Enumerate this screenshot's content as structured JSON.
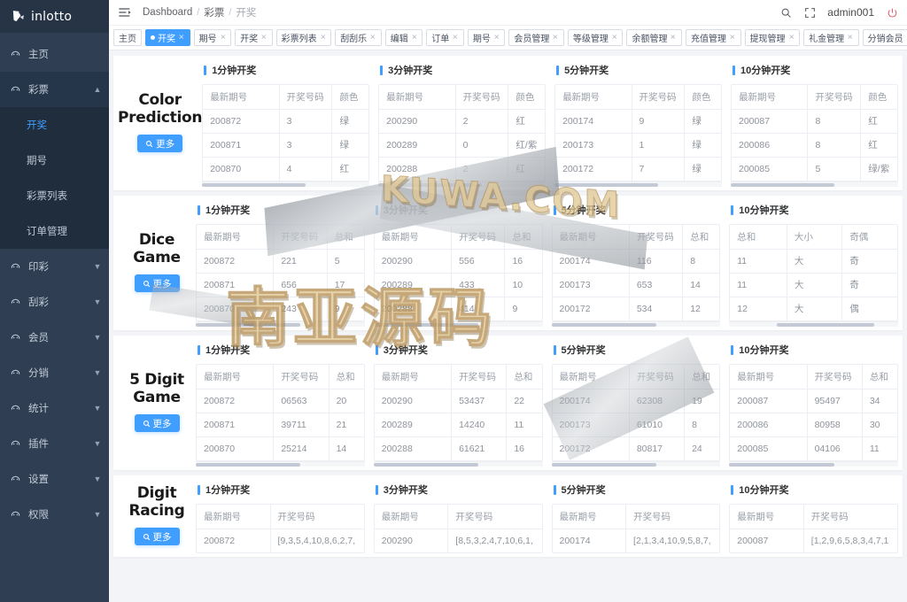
{
  "brand": {
    "name": "inlotto"
  },
  "topbar": {
    "menu_icon": "hamburger-icon",
    "breadcrumb": [
      "Dashboard",
      "彩票",
      "开奖"
    ],
    "separator": "/",
    "search_icon": "search-icon",
    "fullscreen_icon": "fullscreen-icon",
    "username": "admin001",
    "power_icon": "power-icon"
  },
  "tabs": [
    {
      "label": "主页",
      "active": false,
      "closable": false
    },
    {
      "label": "开奖",
      "active": true,
      "closable": true
    },
    {
      "label": "期号",
      "active": false,
      "closable": true
    },
    {
      "label": "开奖",
      "active": false,
      "closable": true
    },
    {
      "label": "彩票列表",
      "active": false,
      "closable": true
    },
    {
      "label": "刮刮乐",
      "active": false,
      "closable": true
    },
    {
      "label": "编辑",
      "active": false,
      "closable": true
    },
    {
      "label": "订单",
      "active": false,
      "closable": true
    },
    {
      "label": "期号",
      "active": false,
      "closable": true
    },
    {
      "label": "会员管理",
      "active": false,
      "closable": true
    },
    {
      "label": "等级管理",
      "active": false,
      "closable": true
    },
    {
      "label": "余额管理",
      "active": false,
      "closable": true
    },
    {
      "label": "充值管理",
      "active": false,
      "closable": true
    },
    {
      "label": "提现管理",
      "active": false,
      "closable": true
    },
    {
      "label": "礼金管理",
      "active": false,
      "closable": true
    },
    {
      "label": "分销会员",
      "active": false,
      "closable": true
    }
  ],
  "sidebar": {
    "items": [
      {
        "label": "主页",
        "icon": "dashboard-icon",
        "expandable": false
      },
      {
        "label": "彩票",
        "icon": "ticket-icon",
        "expandable": true,
        "expanded": true,
        "children": [
          {
            "label": "开奖",
            "active": true
          },
          {
            "label": "期号",
            "active": false
          },
          {
            "label": "彩票列表",
            "active": false
          },
          {
            "label": "订单管理",
            "active": false
          }
        ]
      },
      {
        "label": "印彩",
        "icon": "print-icon",
        "expandable": true,
        "expanded": false
      },
      {
        "label": "刮彩",
        "icon": "scratch-icon",
        "expandable": true,
        "expanded": false
      },
      {
        "label": "会员",
        "icon": "member-icon",
        "expandable": true,
        "expanded": false
      },
      {
        "label": "分销",
        "icon": "distribution-icon",
        "expandable": true,
        "expanded": false
      },
      {
        "label": "统计",
        "icon": "stats-icon",
        "expandable": true,
        "expanded": false
      },
      {
        "label": "插件",
        "icon": "plugin-icon",
        "expandable": true,
        "expanded": false
      },
      {
        "label": "设置",
        "icon": "settings-icon",
        "expandable": true,
        "expanded": false
      },
      {
        "label": "权限",
        "icon": "permission-icon",
        "expandable": true,
        "expanded": false
      }
    ]
  },
  "more_button": {
    "label": "更多",
    "icon": "search-icon"
  },
  "games": [
    {
      "title_line1": "Color",
      "title_line2": "Prediction",
      "panels": [
        {
          "heading": "1分钟开奖",
          "columns": [
            "最新期号",
            "开奖号码",
            "颜色"
          ],
          "col_widths": [
            "46%",
            "32%",
            "22%"
          ],
          "rows": [
            [
              "200872",
              "3",
              "绿"
            ],
            [
              "200871",
              "3",
              "绿"
            ],
            [
              "200870",
              "4",
              "红"
            ]
          ],
          "scroll_pct": 62
        },
        {
          "heading": "3分钟开奖",
          "columns": [
            "最新期号",
            "开奖号码",
            "颜色"
          ],
          "col_widths": [
            "46%",
            "32%",
            "22%"
          ],
          "rows": [
            [
              "200290",
              "2",
              "红"
            ],
            [
              "200289",
              "0",
              "红/紫"
            ],
            [
              "200288",
              "2",
              "红"
            ]
          ],
          "scroll_pct": 62
        },
        {
          "heading": "5分钟开奖",
          "columns": [
            "最新期号",
            "开奖号码",
            "颜色"
          ],
          "col_widths": [
            "46%",
            "32%",
            "22%"
          ],
          "rows": [
            [
              "200174",
              "9",
              "绿"
            ],
            [
              "200173",
              "1",
              "绿"
            ],
            [
              "200172",
              "7",
              "绿"
            ]
          ],
          "scroll_pct": 62
        },
        {
          "heading": "10分钟开奖",
          "columns": [
            "最新期号",
            "开奖号码",
            "颜色"
          ],
          "col_widths": [
            "46%",
            "32%",
            "22%"
          ],
          "rows": [
            [
              "200087",
              "8",
              "红"
            ],
            [
              "200086",
              "8",
              "红"
            ],
            [
              "200085",
              "5",
              "绿/紫"
            ]
          ],
          "scroll_pct": 62
        }
      ]
    },
    {
      "title_line1": "Dice",
      "title_line2": "Game",
      "panels": [
        {
          "heading": "1分钟开奖",
          "columns": [
            "最新期号",
            "开奖号码",
            "总和"
          ],
          "col_widths": [
            "46%",
            "32%",
            "22%"
          ],
          "rows": [
            [
              "200872",
              "221",
              "5"
            ],
            [
              "200871",
              "656",
              "17"
            ],
            [
              "200870",
              "243",
              "9"
            ]
          ],
          "scroll_pct": 62
        },
        {
          "heading": "3分钟开奖",
          "columns": [
            "最新期号",
            "开奖号码",
            "总和"
          ],
          "col_widths": [
            "46%",
            "32%",
            "22%"
          ],
          "rows": [
            [
              "200290",
              "556",
              "16"
            ],
            [
              "200289",
              "433",
              "10"
            ],
            [
              "200288",
              "414",
              "9"
            ]
          ],
          "scroll_pct": 62
        },
        {
          "heading": "5分钟开奖",
          "columns": [
            "最新期号",
            "开奖号码",
            "总和"
          ],
          "col_widths": [
            "46%",
            "32%",
            "22%"
          ],
          "rows": [
            [
              "200174",
              "116",
              "8"
            ],
            [
              "200173",
              "653",
              "14"
            ],
            [
              "200172",
              "534",
              "12"
            ]
          ],
          "scroll_pct": 62
        },
        {
          "heading": "10分钟开奖",
          "columns": [
            "总和",
            "大小",
            "奇偶"
          ],
          "col_widths": [
            "34%",
            "33%",
            "33%"
          ],
          "rows": [
            [
              "11",
              "大",
              "奇"
            ],
            [
              "11",
              "大",
              "奇"
            ],
            [
              "12",
              "大",
              "偶"
            ]
          ],
          "scroll_pct": 58,
          "scroll_offset_pct": 28
        }
      ]
    },
    {
      "title_line1": "5 Digit",
      "title_line2": "Game",
      "panels": [
        {
          "heading": "1分钟开奖",
          "columns": [
            "最新期号",
            "开奖号码",
            "总和"
          ],
          "col_widths": [
            "46%",
            "33%",
            "21%"
          ],
          "rows": [
            [
              "200872",
              "06563",
              "20"
            ],
            [
              "200871",
              "39711",
              "21"
            ],
            [
              "200870",
              "25214",
              "14"
            ]
          ],
          "scroll_pct": 62
        },
        {
          "heading": "3分钟开奖",
          "columns": [
            "最新期号",
            "开奖号码",
            "总和"
          ],
          "col_widths": [
            "46%",
            "33%",
            "21%"
          ],
          "rows": [
            [
              "200290",
              "53437",
              "22"
            ],
            [
              "200289",
              "14240",
              "11"
            ],
            [
              "200288",
              "61621",
              "16"
            ]
          ],
          "scroll_pct": 62
        },
        {
          "heading": "5分钟开奖",
          "columns": [
            "最新期号",
            "开奖号码",
            "总和"
          ],
          "col_widths": [
            "46%",
            "33%",
            "21%"
          ],
          "rows": [
            [
              "200174",
              "62308",
              "19"
            ],
            [
              "200173",
              "61010",
              "8"
            ],
            [
              "200172",
              "80817",
              "24"
            ]
          ],
          "scroll_pct": 62
        },
        {
          "heading": "10分钟开奖",
          "columns": [
            "最新期号",
            "开奖号码",
            "总和"
          ],
          "col_widths": [
            "46%",
            "33%",
            "21%"
          ],
          "rows": [
            [
              "200087",
              "95497",
              "34"
            ],
            [
              "200086",
              "80958",
              "30"
            ],
            [
              "200085",
              "04106",
              "11"
            ]
          ],
          "scroll_pct": 62
        }
      ]
    },
    {
      "title_line1": "Digit",
      "title_line2": "Racing",
      "panels": [
        {
          "heading": "1分钟开奖",
          "columns": [
            "最新期号",
            "开奖号码"
          ],
          "col_widths": [
            "44%",
            "56%"
          ],
          "rows": [
            [
              "200872",
              "[9,3,5,4,10,8,6,2,7,"
            ]
          ],
          "scroll_pct": 62
        },
        {
          "heading": "3分钟开奖",
          "columns": [
            "最新期号",
            "开奖号码"
          ],
          "col_widths": [
            "44%",
            "56%"
          ],
          "rows": [
            [
              "200290",
              "[8,5,3,2,4,7,10,6,1,"
            ]
          ],
          "scroll_pct": 62
        },
        {
          "heading": "5分钟开奖",
          "columns": [
            "最新期号",
            "开奖号码"
          ],
          "col_widths": [
            "44%",
            "56%"
          ],
          "rows": [
            [
              "200174",
              "[2,1,3,4,10,9,5,8,7,"
            ]
          ],
          "scroll_pct": 62
        },
        {
          "heading": "10分钟开奖",
          "columns": [
            "最新期号",
            "开奖号码"
          ],
          "col_widths": [
            "44%",
            "56%"
          ],
          "rows": [
            [
              "200087",
              "[1,2,9,6,5,8,3,4,7,1"
            ]
          ],
          "scroll_pct": 62
        }
      ]
    }
  ],
  "watermarks": {
    "primary": "南亚源码",
    "secondary": "KUWA.COM"
  },
  "colors": {
    "accent": "#409eff",
    "sidebar_bg": "#2f3e53",
    "sidebar_sub_bg": "#1f2d3d",
    "page_bg": "#f2f4f7",
    "power_red": "#e4606d"
  }
}
